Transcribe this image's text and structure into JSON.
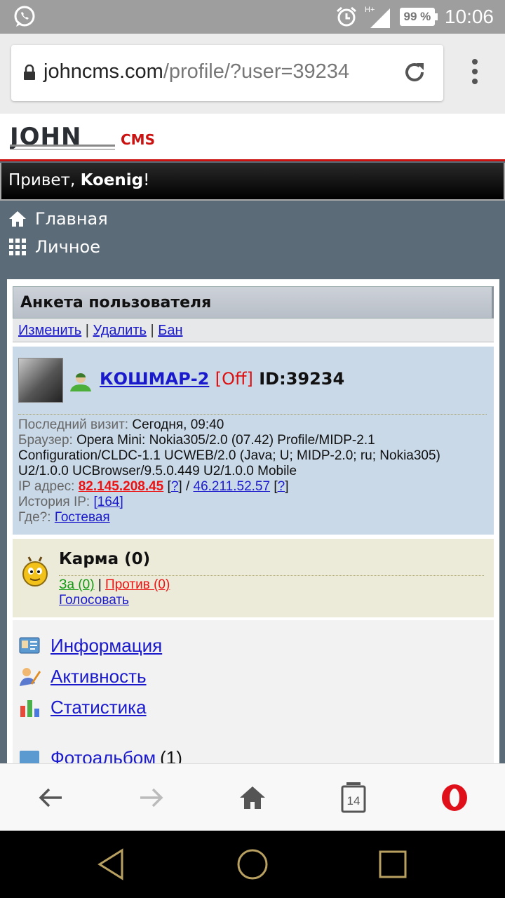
{
  "status_bar": {
    "time": "10:06",
    "battery": "99 %",
    "network": "H+",
    "icons": [
      "whatsapp-icon",
      "alarm-icon",
      "signal-icon",
      "battery-icon"
    ]
  },
  "browser": {
    "url_host": "johncms.com",
    "url_path": "/profile/?user=39234",
    "tabs_count": "14"
  },
  "site": {
    "greeting_prefix": "Привет, ",
    "username": "Koenig",
    "greeting_suffix": "!",
    "nav": [
      {
        "label": "Главная",
        "icon": "home-icon"
      },
      {
        "label": "Личное",
        "icon": "grid-icon"
      }
    ]
  },
  "profile": {
    "header": "Анкета пользователя",
    "actions": {
      "edit": "Изменить",
      "delete": "Удалить",
      "ban": "Бан",
      "sep": "|"
    },
    "name": "КОШМАР-2",
    "status": "[Off]",
    "id": "ID:39234",
    "last_visit_label": "Последний визит:",
    "last_visit": "Сегодня, 09:40",
    "browser_label": "Браузер:",
    "browser_ua": "Opera Mini: Nokia305/2.0 (07.42) Profile/MIDP-2.1 Configuration/CLDC-1.1 UCWEB/2.0 (Java; U; MIDP-2.0; ru; Nokia305) U2/1.0.0 UCBrowser/9.5.0.449 U2/1.0.0 Mobile",
    "ip_label": "IP адрес:",
    "ip1": "82.145.208.45",
    "ip_q": "?",
    "ip_sep": " / ",
    "ip2": "46.211.52.57",
    "ip_history_label": "История IP:",
    "ip_history": "[164]",
    "where_label": "Где?:",
    "where": "Гостевая"
  },
  "karma": {
    "title": "Карма (0)",
    "for": "За (0)",
    "against": "Против (0)",
    "sep": "|",
    "vote": "Голосовать"
  },
  "menu": [
    {
      "label": "Информация",
      "icon": "info-card-icon"
    },
    {
      "label": "Активность",
      "icon": "activity-icon"
    },
    {
      "label": "Статистика",
      "icon": "stats-icon"
    }
  ],
  "photo_album": {
    "label": "Фотоальбом",
    "count": "(1)"
  },
  "colors": {
    "accent_red": "#cc1111",
    "link": "#1a1acc",
    "page_bg": "#5c6b78"
  }
}
